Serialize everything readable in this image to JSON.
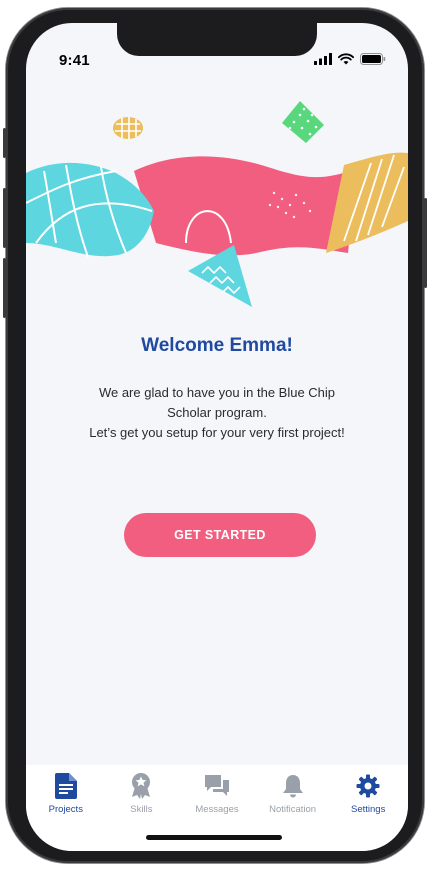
{
  "status_bar": {
    "time": "9:41"
  },
  "welcome": {
    "title": "Welcome Emma!",
    "lines": [
      "We are glad to have you in the Blue Chip",
      "Scholar program.",
      "Let’s get you setup for your very first project!"
    ]
  },
  "cta": {
    "label": "GET STARTED"
  },
  "tabbar": {
    "items": [
      {
        "label": "Projects",
        "icon": "document-icon",
        "active": true
      },
      {
        "label": "Skills",
        "icon": "award-icon",
        "active": false
      },
      {
        "label": "Messages",
        "icon": "chat-icon",
        "active": false
      },
      {
        "label": "Notification",
        "icon": "bell-icon",
        "active": false
      },
      {
        "label": "Settings",
        "icon": "gear-icon",
        "active": true
      }
    ]
  },
  "colors": {
    "primary": "#1f4aa0",
    "accent": "#f25e7f",
    "teal": "#5ed6df",
    "yellow": "#ebbd5d",
    "green": "#59d77d",
    "inactive": "#9aa0aa",
    "background": "#f5f6fa"
  }
}
